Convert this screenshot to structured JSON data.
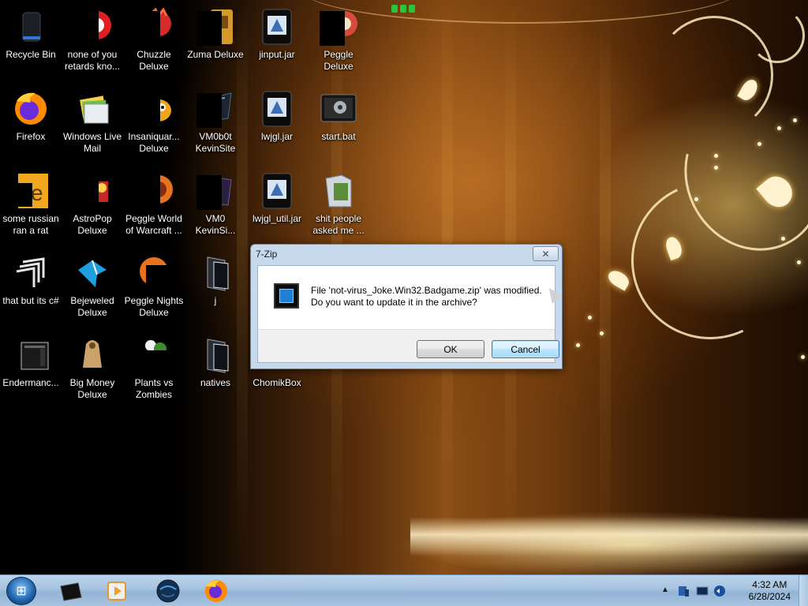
{
  "desktop": {
    "icons": [
      {
        "id": "recycle-bin",
        "label": "Recycle Bin"
      },
      {
        "id": "none-of-you",
        "label": "none of you retards kno..."
      },
      {
        "id": "chuzzle",
        "label": "Chuzzle Deluxe"
      },
      {
        "id": "zuma",
        "label": "Zuma Deluxe"
      },
      {
        "id": "jinput",
        "label": "jinput.jar"
      },
      {
        "id": "peggle",
        "label": "Peggle Deluxe"
      },
      {
        "id": "firefox",
        "label": "Firefox"
      },
      {
        "id": "windows-live-mail",
        "label": "Windows Live Mail"
      },
      {
        "id": "insaniquarium",
        "label": "Insaniquar... Deluxe"
      },
      {
        "id": "vm0b0t",
        "label": "VM0b0t KevinSite"
      },
      {
        "id": "lwjgl",
        "label": "lwjgl.jar"
      },
      {
        "id": "start-bat",
        "label": "start.bat"
      },
      {
        "id": "some-russian",
        "label": "some russian ran a rat"
      },
      {
        "id": "astropop",
        "label": "AstroPop Deluxe"
      },
      {
        "id": "peggle-wow",
        "label": "Peggle World of Warcraft ..."
      },
      {
        "id": "vm0-kevinsi",
        "label": "VM0 KevinSi..."
      },
      {
        "id": "lwjgl-util",
        "label": "lwjgl_util.jar"
      },
      {
        "id": "shit-people",
        "label": "shit people asked me ..."
      },
      {
        "id": "that-but-c",
        "label": "that but its c#"
      },
      {
        "id": "bejeweled",
        "label": "Bejeweled Deluxe"
      },
      {
        "id": "peggle-nights",
        "label": "Peggle Nights Deluxe"
      },
      {
        "id": "j-folder",
        "label": "j"
      },
      {
        "id": "endermanc",
        "label": "Endermanc..."
      },
      {
        "id": "big-money",
        "label": "Big Money Deluxe"
      },
      {
        "id": "plants-vs-zombies",
        "label": "Plants vs Zombies"
      },
      {
        "id": "natives",
        "label": "natives"
      },
      {
        "id": "chomikbox",
        "label": "ChomikBox"
      }
    ]
  },
  "dialog": {
    "title": "7-Zip",
    "close_label": "✕",
    "message_line1": "File 'not-virus_Joke.Win32.Badgame.zip' was modified.",
    "message_line2": "Do you want to update it in the archive?",
    "ok_label": "OK",
    "cancel_label": "Cancel"
  },
  "taskbar": {
    "start_label": "⊞",
    "apps": [
      "media-player-app",
      "windows-media-center-app",
      "browser-globe-app",
      "firefox-app"
    ],
    "tray": {
      "show_hidden_label": "▲",
      "time": "4:32 AM",
      "date": "6/28/2024"
    }
  }
}
